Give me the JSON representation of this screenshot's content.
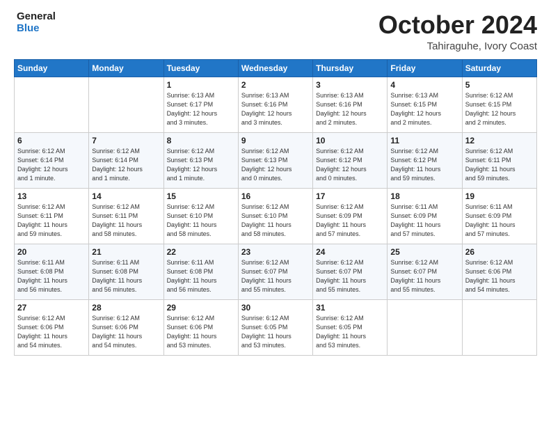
{
  "logo": {
    "line1": "General",
    "line2": "Blue"
  },
  "header": {
    "month": "October 2024",
    "location": "Tahiraguhe, Ivory Coast"
  },
  "weekdays": [
    "Sunday",
    "Monday",
    "Tuesday",
    "Wednesday",
    "Thursday",
    "Friday",
    "Saturday"
  ],
  "weeks": [
    [
      {
        "day": "",
        "info": ""
      },
      {
        "day": "",
        "info": ""
      },
      {
        "day": "1",
        "info": "Sunrise: 6:13 AM\nSunset: 6:17 PM\nDaylight: 12 hours\nand 3 minutes."
      },
      {
        "day": "2",
        "info": "Sunrise: 6:13 AM\nSunset: 6:16 PM\nDaylight: 12 hours\nand 3 minutes."
      },
      {
        "day": "3",
        "info": "Sunrise: 6:13 AM\nSunset: 6:16 PM\nDaylight: 12 hours\nand 2 minutes."
      },
      {
        "day": "4",
        "info": "Sunrise: 6:13 AM\nSunset: 6:15 PM\nDaylight: 12 hours\nand 2 minutes."
      },
      {
        "day": "5",
        "info": "Sunrise: 6:12 AM\nSunset: 6:15 PM\nDaylight: 12 hours\nand 2 minutes."
      }
    ],
    [
      {
        "day": "6",
        "info": "Sunrise: 6:12 AM\nSunset: 6:14 PM\nDaylight: 12 hours\nand 1 minute."
      },
      {
        "day": "7",
        "info": "Sunrise: 6:12 AM\nSunset: 6:14 PM\nDaylight: 12 hours\nand 1 minute."
      },
      {
        "day": "8",
        "info": "Sunrise: 6:12 AM\nSunset: 6:13 PM\nDaylight: 12 hours\nand 1 minute."
      },
      {
        "day": "9",
        "info": "Sunrise: 6:12 AM\nSunset: 6:13 PM\nDaylight: 12 hours\nand 0 minutes."
      },
      {
        "day": "10",
        "info": "Sunrise: 6:12 AM\nSunset: 6:12 PM\nDaylight: 12 hours\nand 0 minutes."
      },
      {
        "day": "11",
        "info": "Sunrise: 6:12 AM\nSunset: 6:12 PM\nDaylight: 11 hours\nand 59 minutes."
      },
      {
        "day": "12",
        "info": "Sunrise: 6:12 AM\nSunset: 6:11 PM\nDaylight: 11 hours\nand 59 minutes."
      }
    ],
    [
      {
        "day": "13",
        "info": "Sunrise: 6:12 AM\nSunset: 6:11 PM\nDaylight: 11 hours\nand 59 minutes."
      },
      {
        "day": "14",
        "info": "Sunrise: 6:12 AM\nSunset: 6:11 PM\nDaylight: 11 hours\nand 58 minutes."
      },
      {
        "day": "15",
        "info": "Sunrise: 6:12 AM\nSunset: 6:10 PM\nDaylight: 11 hours\nand 58 minutes."
      },
      {
        "day": "16",
        "info": "Sunrise: 6:12 AM\nSunset: 6:10 PM\nDaylight: 11 hours\nand 58 minutes."
      },
      {
        "day": "17",
        "info": "Sunrise: 6:12 AM\nSunset: 6:09 PM\nDaylight: 11 hours\nand 57 minutes."
      },
      {
        "day": "18",
        "info": "Sunrise: 6:11 AM\nSunset: 6:09 PM\nDaylight: 11 hours\nand 57 minutes."
      },
      {
        "day": "19",
        "info": "Sunrise: 6:11 AM\nSunset: 6:09 PM\nDaylight: 11 hours\nand 57 minutes."
      }
    ],
    [
      {
        "day": "20",
        "info": "Sunrise: 6:11 AM\nSunset: 6:08 PM\nDaylight: 11 hours\nand 56 minutes."
      },
      {
        "day": "21",
        "info": "Sunrise: 6:11 AM\nSunset: 6:08 PM\nDaylight: 11 hours\nand 56 minutes."
      },
      {
        "day": "22",
        "info": "Sunrise: 6:11 AM\nSunset: 6:08 PM\nDaylight: 11 hours\nand 56 minutes."
      },
      {
        "day": "23",
        "info": "Sunrise: 6:12 AM\nSunset: 6:07 PM\nDaylight: 11 hours\nand 55 minutes."
      },
      {
        "day": "24",
        "info": "Sunrise: 6:12 AM\nSunset: 6:07 PM\nDaylight: 11 hours\nand 55 minutes."
      },
      {
        "day": "25",
        "info": "Sunrise: 6:12 AM\nSunset: 6:07 PM\nDaylight: 11 hours\nand 55 minutes."
      },
      {
        "day": "26",
        "info": "Sunrise: 6:12 AM\nSunset: 6:06 PM\nDaylight: 11 hours\nand 54 minutes."
      }
    ],
    [
      {
        "day": "27",
        "info": "Sunrise: 6:12 AM\nSunset: 6:06 PM\nDaylight: 11 hours\nand 54 minutes."
      },
      {
        "day": "28",
        "info": "Sunrise: 6:12 AM\nSunset: 6:06 PM\nDaylight: 11 hours\nand 54 minutes."
      },
      {
        "day": "29",
        "info": "Sunrise: 6:12 AM\nSunset: 6:06 PM\nDaylight: 11 hours\nand 53 minutes."
      },
      {
        "day": "30",
        "info": "Sunrise: 6:12 AM\nSunset: 6:05 PM\nDaylight: 11 hours\nand 53 minutes."
      },
      {
        "day": "31",
        "info": "Sunrise: 6:12 AM\nSunset: 6:05 PM\nDaylight: 11 hours\nand 53 minutes."
      },
      {
        "day": "",
        "info": ""
      },
      {
        "day": "",
        "info": ""
      }
    ]
  ]
}
